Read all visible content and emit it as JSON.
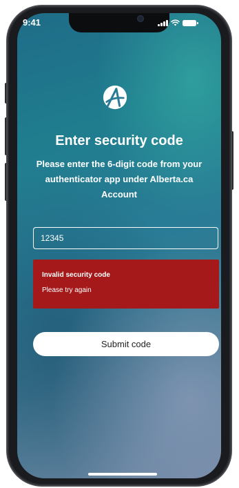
{
  "status_bar": {
    "time": "9:41",
    "icons": [
      "cellular-signal-icon",
      "wifi-icon",
      "battery-icon"
    ]
  },
  "logo": {
    "icon": "alberta-logo-icon",
    "color": "#ffffff"
  },
  "page": {
    "title": "Enter security code",
    "instructions": "Please enter the 6-digit code from your authenticator app under Alberta.ca Account"
  },
  "code_input": {
    "value": "12345",
    "placeholder": ""
  },
  "error": {
    "title": "Invalid security code",
    "message": "Please try again",
    "background": "#a6191a"
  },
  "submit": {
    "label": "Submit code"
  },
  "colors": {
    "background_top": "#1f6c88",
    "background_bottom": "#6d86a2",
    "text": "#ffffff",
    "button_bg": "#ffffff",
    "button_text": "#222222"
  }
}
